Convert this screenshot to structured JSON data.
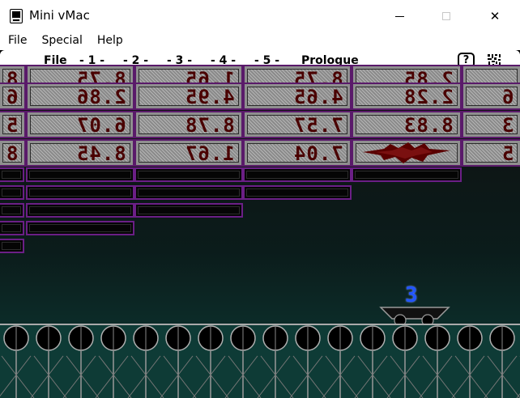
{
  "window": {
    "title": "Mini vMac",
    "minimize_glyph": "—",
    "close_glyph": "✕"
  },
  "win_menu": [
    "File",
    "Special",
    "Help"
  ],
  "mac_menu": {
    "apple_glyph": "",
    "items": [
      "File",
      "- 1 -",
      "- 2 -",
      "- 3 -",
      "- 4 -",
      "- 5 -",
      "Prologue"
    ],
    "help_glyph": "?"
  },
  "game": {
    "countdown": "3",
    "rows": [
      [
        "8.75",
        "1.65",
        "8.75",
        "2.85",
        ""
      ],
      [
        "2.86",
        "4.95",
        "4.65",
        "2.28",
        "6"
      ],
      [
        "6.07",
        "8.78",
        "7.57",
        "8.83",
        "3"
      ],
      [
        "8.45",
        "1.67",
        "7.04",
        "",
        "5"
      ]
    ],
    "left_edge_digits": [
      "8",
      "6",
      "5",
      "8"
    ]
  },
  "colors": {
    "tile_border": "#5a1a6a",
    "cell_border": "#6b1f86",
    "score_text": "#4a0000",
    "countdown": "#2255ff",
    "floor": "#0e3b36"
  }
}
